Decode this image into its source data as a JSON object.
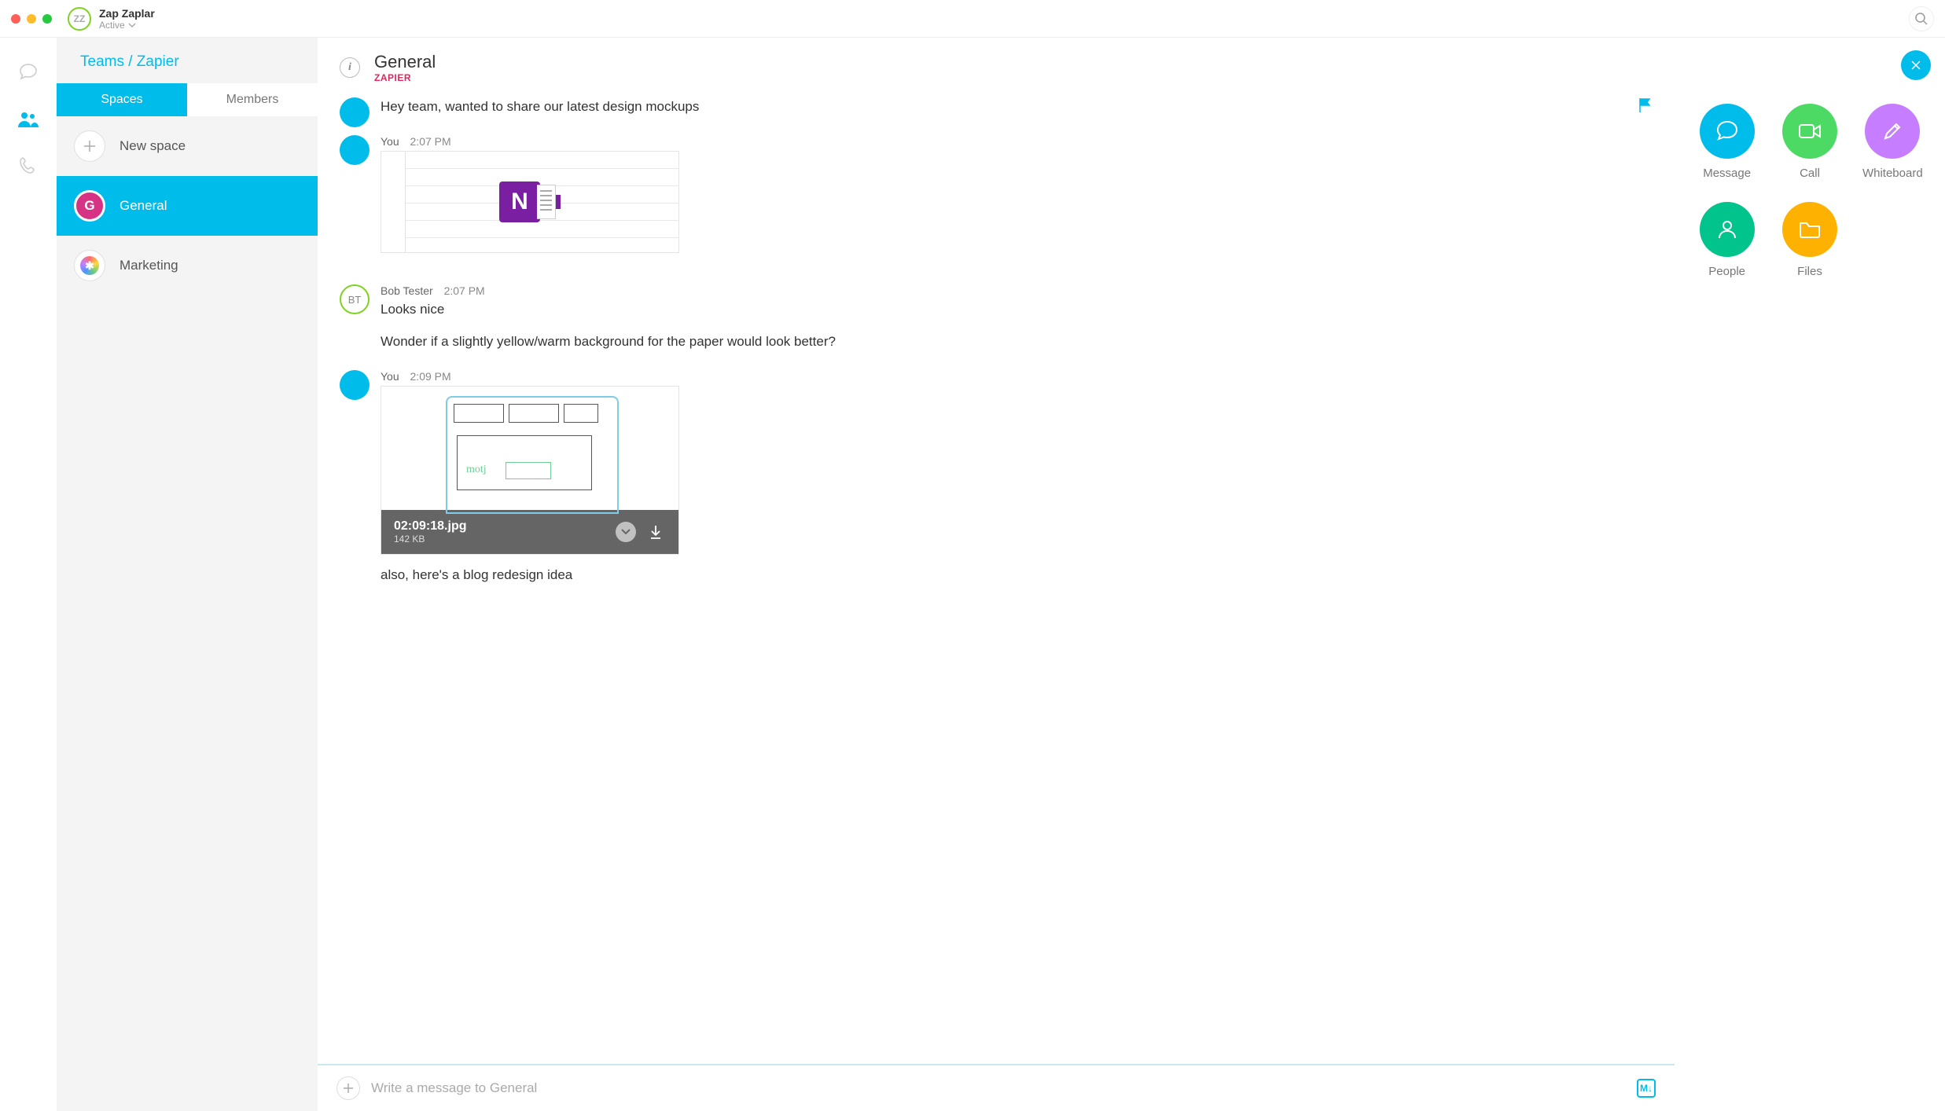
{
  "titlebar": {
    "avatar_initials": "ZZ",
    "user_name": "Zap Zaplar",
    "status": "Active"
  },
  "breadcrumb": "Teams / Zapier",
  "tabs": {
    "spaces": "Spaces",
    "members": "Members"
  },
  "sidebar": {
    "new_space": "New space",
    "items": [
      {
        "initial": "G",
        "label": "General"
      },
      {
        "label": "Marketing"
      }
    ]
  },
  "chat_header": {
    "title": "General",
    "subtitle": "ZAPIER"
  },
  "messages": {
    "m0": {
      "text": "Hey team, wanted to share our latest design mockups"
    },
    "m1": {
      "author": "You",
      "time": "2:07 PM"
    },
    "m2": {
      "author": "Bob Tester",
      "time": "2:07 PM",
      "initials": "BT",
      "text1": "Looks nice",
      "text2": "Wonder if a slightly yellow/warm background for the paper would look better?"
    },
    "m3": {
      "author": "You",
      "time": "2:09 PM",
      "attachment_name": "02:09:18.jpg",
      "attachment_size": "142 KB",
      "sketch_label": "motj",
      "text_after": "also, here's a blog redesign idea"
    }
  },
  "composer": {
    "placeholder": "Write a message to General",
    "markdown": "M↓"
  },
  "actions": {
    "message": "Message",
    "call": "Call",
    "whiteboard": "Whiteboard",
    "people": "People",
    "files": "Files"
  }
}
